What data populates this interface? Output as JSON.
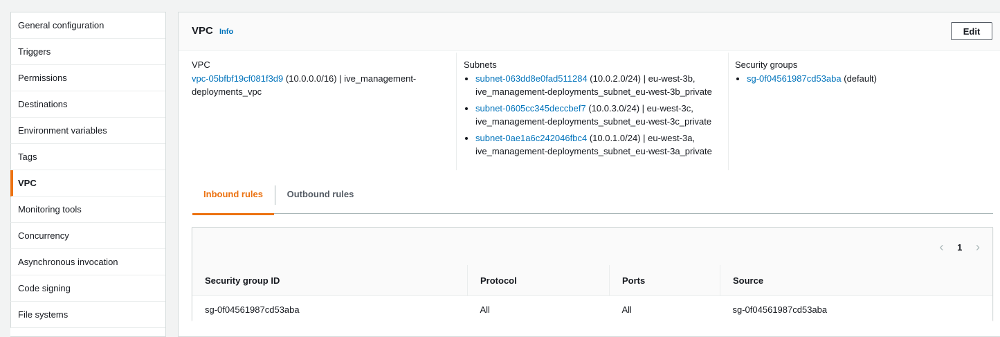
{
  "sidebar": {
    "items": [
      {
        "label": "General configuration"
      },
      {
        "label": "Triggers"
      },
      {
        "label": "Permissions"
      },
      {
        "label": "Destinations"
      },
      {
        "label": "Environment variables"
      },
      {
        "label": "Tags"
      },
      {
        "label": "VPC",
        "active": true
      },
      {
        "label": "Monitoring tools"
      },
      {
        "label": "Concurrency"
      },
      {
        "label": "Asynchronous invocation"
      },
      {
        "label": "Code signing"
      },
      {
        "label": "File systems"
      }
    ]
  },
  "header": {
    "title": "VPC",
    "info": "Info",
    "edit_label": "Edit"
  },
  "vpc": {
    "label": "VPC",
    "id": "vpc-05bfbf19cf081f3d9",
    "details_line1": " (10.0.0.0/16) | ive_management-",
    "details_line2": "deployments_vpc"
  },
  "subnets": {
    "label": "Subnets",
    "items": [
      {
        "id": "subnet-063dd8e0fad511284",
        "detail": " (10.0.2.0/24) | eu-west-3b,",
        "name": "ive_management-deployments_subnet_eu-west-3b_private"
      },
      {
        "id": "subnet-0605cc345deccbef7",
        "detail": " (10.0.3.0/24) | eu-west-3c,",
        "name": "ive_management-deployments_subnet_eu-west-3c_private"
      },
      {
        "id": "subnet-0ae1a6c242046fbc4",
        "detail": " (10.0.1.0/24) | eu-west-3a,",
        "name": "ive_management-deployments_subnet_eu-west-3a_private"
      }
    ]
  },
  "security_groups": {
    "label": "Security groups",
    "items": [
      {
        "id": "sg-0f04561987cd53aba",
        "detail": " (default)"
      }
    ]
  },
  "tabs": {
    "inbound": "Inbound rules",
    "outbound": "Outbound rules"
  },
  "pager": {
    "prev_icon": "chevron-left-icon",
    "page": "1",
    "next_icon": "chevron-right-icon"
  },
  "rules_table": {
    "headers": [
      "Security group ID",
      "Protocol",
      "Ports",
      "Source"
    ],
    "rows": [
      [
        "sg-0f04561987cd53aba",
        "All",
        "All",
        "sg-0f04561987cd53aba"
      ]
    ]
  },
  "colors": {
    "accent": "#ec7211",
    "link": "#0073bb"
  }
}
